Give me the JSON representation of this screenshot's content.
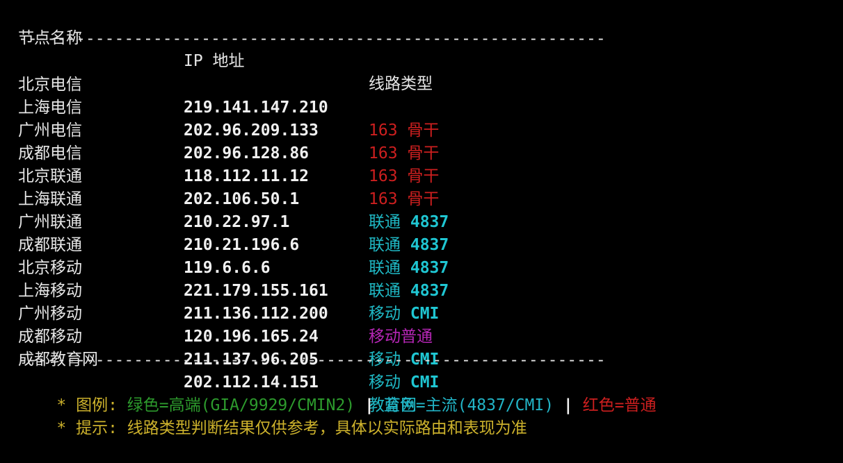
{
  "header": {
    "col_node": "节点名称",
    "col_ip": "IP 地址",
    "col_route": "线路类型"
  },
  "divider": "-------------------------------------------------------------",
  "rows": [
    {
      "node": "北京电信",
      "ip": "219.141.147.210",
      "route_a": "163 骨干",
      "route_b": "",
      "style": "red"
    },
    {
      "node": "上海电信",
      "ip": "202.96.209.133",
      "route_a": "163 骨干",
      "route_b": "",
      "style": "red"
    },
    {
      "node": "广州电信",
      "ip": "202.96.128.86",
      "route_a": "163 骨干",
      "route_b": "",
      "style": "red"
    },
    {
      "node": "成都电信",
      "ip": "118.112.11.12",
      "route_a": "163 骨干",
      "route_b": "",
      "style": "red"
    },
    {
      "node": "北京联通",
      "ip": "202.106.50.1",
      "route_a": "联通 ",
      "route_b": "4837",
      "style": "cyan"
    },
    {
      "node": "上海联通",
      "ip": "210.22.97.1",
      "route_a": "联通 ",
      "route_b": "4837",
      "style": "cyan"
    },
    {
      "node": "广州联通",
      "ip": "210.21.196.6",
      "route_a": "联通 ",
      "route_b": "4837",
      "style": "cyan"
    },
    {
      "node": "成都联通",
      "ip": "119.6.6.6",
      "route_a": "联通 ",
      "route_b": "4837",
      "style": "cyan"
    },
    {
      "node": "北京移动",
      "ip": "221.179.155.161",
      "route_a": "移动 ",
      "route_b": "CMI",
      "style": "cyan"
    },
    {
      "node": "上海移动",
      "ip": "211.136.112.200",
      "route_a": "移动普通",
      "route_b": "",
      "style": "magenta"
    },
    {
      "node": "广州移动",
      "ip": "120.196.165.24",
      "route_a": "移动 ",
      "route_b": "CMI",
      "style": "cyan"
    },
    {
      "node": "成都移动",
      "ip": "211.137.96.205",
      "route_a": "移动 ",
      "route_b": "CMI",
      "style": "cyan"
    },
    {
      "node": "成都教育网",
      "ip": "202.112.14.151",
      "route_a": "教育网",
      "route_b": "",
      "style": "cyan"
    }
  ],
  "legend": {
    "bullet": "* ",
    "label": "图例: ",
    "green_text": "绿色=高端(GIA/9929/CMIN2)",
    "sep": " | ",
    "blue_text": "蓝色=主流(4837/CMI)",
    "red_text": "红色=普通"
  },
  "tip": {
    "bullet": "* ",
    "text": "提示: 线路类型判断结果仅供参考，具体以实际路由和表现为准"
  },
  "colors": {
    "background": "#000000",
    "red": "#cd1f1f",
    "cyan": "#1fb8c4",
    "magenta": "#b526b5",
    "yellow": "#cdb22c",
    "green": "#2d9b2d"
  }
}
